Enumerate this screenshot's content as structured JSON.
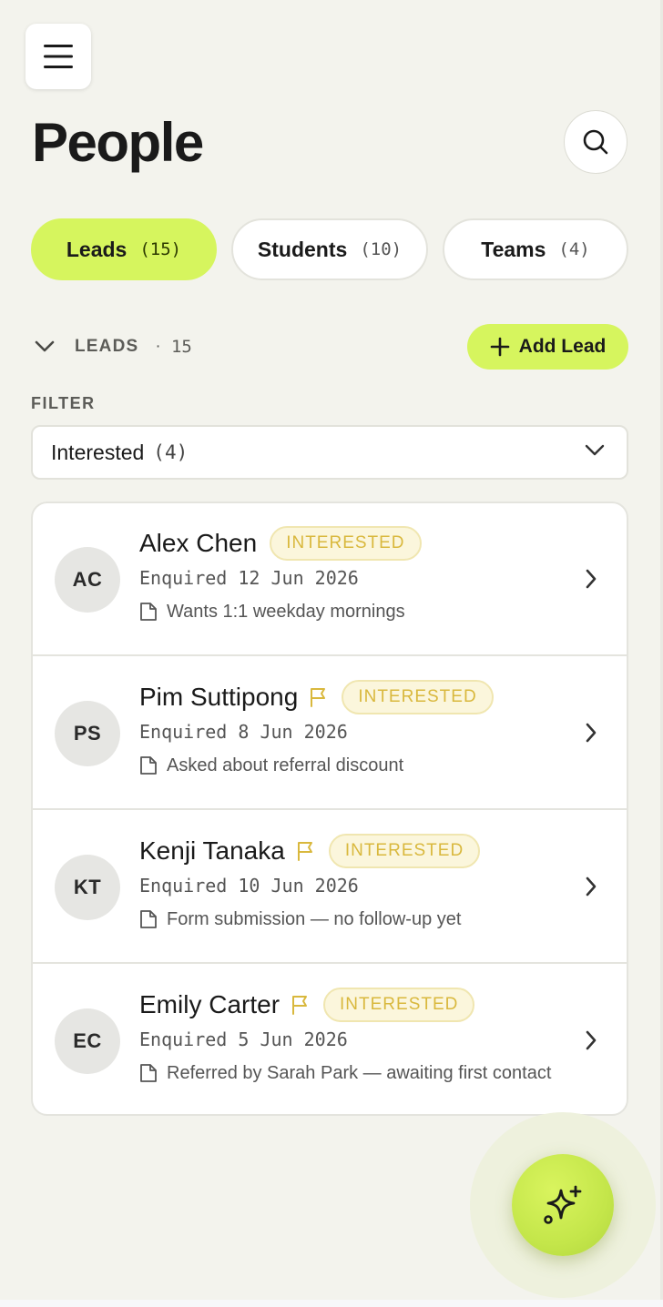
{
  "header": {
    "title": "People"
  },
  "tabs": [
    {
      "label": "Leads",
      "count": "(15)",
      "active": true
    },
    {
      "label": "Students",
      "count": "(10)",
      "active": false
    },
    {
      "label": "Teams",
      "count": "(4)",
      "active": false
    }
  ],
  "section": {
    "label": "LEADS",
    "dot": "·",
    "count": "15",
    "add_label": "Add Lead"
  },
  "filter": {
    "label": "FILTER",
    "value": "Interested",
    "count": "(4)"
  },
  "leads": [
    {
      "initials": "AC",
      "name": "Alex Chen",
      "flagged": false,
      "status": "INTERESTED",
      "enquired": "Enquired 12 Jun 2026",
      "note": "Wants 1:1 weekday mornings"
    },
    {
      "initials": "PS",
      "name": "Pim Suttipong",
      "flagged": true,
      "status": "INTERESTED",
      "enquired": "Enquired 8 Jun 2026",
      "note": "Asked about referral discount"
    },
    {
      "initials": "KT",
      "name": "Kenji Tanaka",
      "flagged": true,
      "status": "INTERESTED",
      "enquired": "Enquired 10 Jun 2026",
      "note": "Form submission — no follow-up yet"
    },
    {
      "initials": "EC",
      "name": "Emily Carter",
      "flagged": true,
      "status": "INTERESTED",
      "enquired": "Enquired 5 Jun 2026",
      "note": "Referred by Sarah Park — awaiting first contact"
    }
  ],
  "icons": {
    "menu": "hamburger-icon",
    "search": "search-icon",
    "collapse": "chevron-down-icon",
    "add": "plus-icon",
    "dropdown": "chevron-down-icon",
    "flag": "flag-icon",
    "note": "note-icon",
    "row_arrow": "chevron-right-icon",
    "fab": "sparkles-icon"
  },
  "colors": {
    "accent": "#d6f55e",
    "badge_text": "#d9b83d",
    "badge_bg": "#fbf6dc",
    "background": "#f3f3ed"
  }
}
